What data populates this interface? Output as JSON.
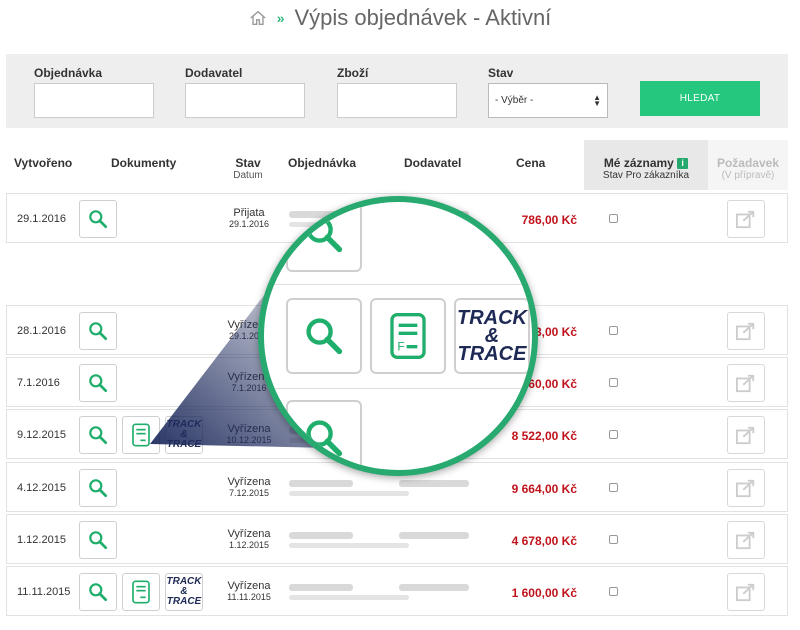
{
  "header": {
    "home_icon": "home-icon",
    "separator": "»",
    "title": "Výpis objednávek - Aktivní"
  },
  "filter": {
    "order_label": "Objednávka",
    "order_value": "",
    "supplier_label": "Dodavatel",
    "supplier_value": "",
    "goods_label": "Zboží",
    "goods_value": "",
    "state_label": "Stav",
    "state_selected": "- Výběr -",
    "search_button": "HLEDAT"
  },
  "table": {
    "headers": {
      "created": "Vytvořeno",
      "documents": "Dokumenty",
      "state": "Stav",
      "state_sub": "Datum",
      "order": "Objednávka",
      "supplier": "Dodavatel",
      "price": "Cena",
      "my_records": "Mé záznamy",
      "my_records_info": "i",
      "my_records_sub": "Stav  Pro zákazníka",
      "request": "Požadavek",
      "request_sub": "(V přípravě)"
    },
    "rows": [
      {
        "created": "29.1.2016",
        "state": "Přijata",
        "state_date": "29.1.2016",
        "price": "786,00 Kč",
        "docs": [
          "view"
        ]
      },
      {
        "created": "28.1.2016",
        "state": "Vyřízena",
        "state_date": "29.1.2016",
        "price": "3,00 Kč",
        "docs": [
          "view"
        ]
      },
      {
        "created": "7.1.2016",
        "state": "Vyřízena",
        "state_date": "7.1.2016",
        "price": "60,00 Kč",
        "docs": [
          "view"
        ]
      },
      {
        "created": "9.12.2015",
        "state": "Vyřízena",
        "state_date": "10.12.2015",
        "price": "8 522,00 Kč",
        "docs": [
          "view",
          "invoice",
          "track"
        ]
      },
      {
        "created": "4.12.2015",
        "state": "Vyřízena",
        "state_date": "7.12.2015",
        "price": "9 664,00 Kč",
        "docs": [
          "view"
        ]
      },
      {
        "created": "1.12.2015",
        "state": "Vyřízena",
        "state_date": "1.12.2015",
        "price": "4 678,00 Kč",
        "docs": [
          "view"
        ]
      },
      {
        "created": "11.11.2015",
        "state": "Vyřízena",
        "state_date": "11.11.2015",
        "price": "1 600,00 Kč",
        "docs": [
          "view",
          "invoice",
          "track"
        ]
      }
    ]
  },
  "callout": {
    "track_line1": "TRACK",
    "track_line2": "&",
    "track_line3": "TRACE"
  },
  "colors": {
    "accent": "#25c77e",
    "accent_dark": "#27a96f",
    "price": "#c0121b",
    "track_text": "#1e2a55"
  }
}
